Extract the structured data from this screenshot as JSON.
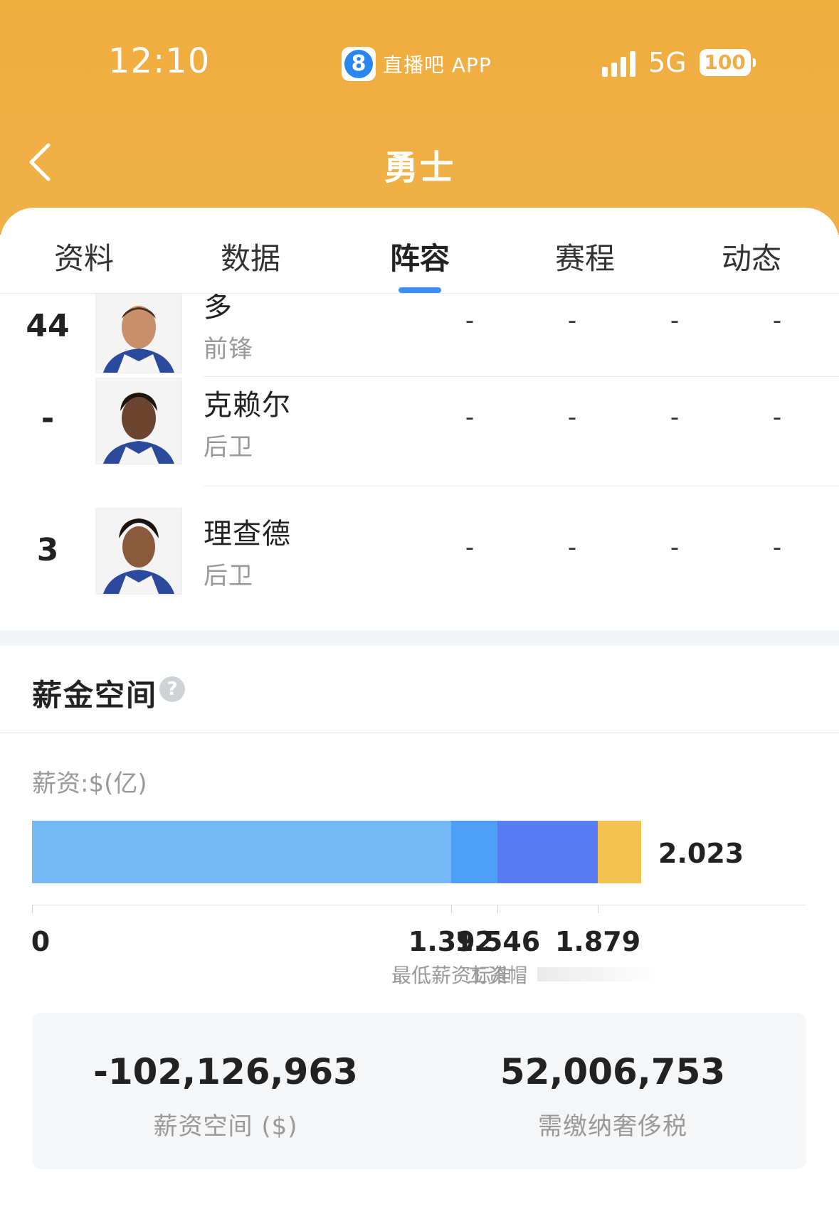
{
  "status_bar": {
    "time": "12:10",
    "app_logo_glyph": "8",
    "app_name": "直播吧 APP",
    "network": "5G",
    "battery": "100"
  },
  "header": {
    "title": "勇士",
    "back_icon": "chevron-left-icon"
  },
  "tabs": [
    {
      "label": "资料",
      "active": false
    },
    {
      "label": "数据",
      "active": false
    },
    {
      "label": "阵容",
      "active": true
    },
    {
      "label": "赛程",
      "active": false
    },
    {
      "label": "动态",
      "active": false
    }
  ],
  "roster": [
    {
      "number": "44",
      "name": "多",
      "position": "前锋",
      "stats": [
        "-",
        "-",
        "-",
        "-"
      ]
    },
    {
      "number": "-",
      "name": "克赖尔",
      "position": "后卫",
      "stats": [
        "-",
        "-",
        "-",
        "-"
      ]
    },
    {
      "number": "3",
      "name": "理查德",
      "position": "后卫",
      "stats": [
        "-",
        "-",
        "-",
        "-"
      ]
    }
  ],
  "salary": {
    "title": "薪金空间",
    "help_icon": "question-icon",
    "unit_label": "薪资:$(亿)",
    "total_label": "2.023",
    "scale_max": 2.023,
    "segments": [
      {
        "value": 1.392,
        "color": "#74b9f6"
      },
      {
        "value": 0.154,
        "color": "#4c9ff4"
      },
      {
        "value": 0.333,
        "color": "#5a7cf2"
      },
      {
        "value": 0.144,
        "color": "#f3c14f"
      }
    ],
    "ticks": [
      {
        "value": 0,
        "label": "0",
        "sub": ""
      },
      {
        "value": 1.392,
        "label": "1.392",
        "sub": "最低薪资标准"
      },
      {
        "value": 1.546,
        "label": "1.546",
        "sub": "工资帽"
      },
      {
        "value": 1.879,
        "label": "1.879",
        "sub": ""
      }
    ]
  },
  "summary": {
    "cap_space_value": "-102,126,963",
    "cap_space_label": "薪资空间 ($)",
    "tax_value": "52,006,753",
    "tax_label": "需缴纳奢侈税"
  }
}
